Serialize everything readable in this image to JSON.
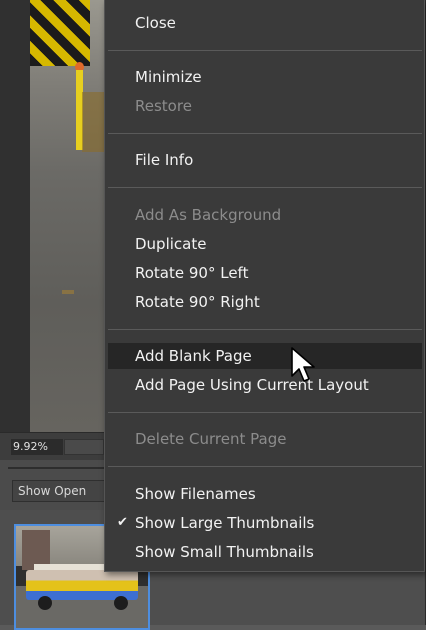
{
  "status": {
    "zoom": "9.92%"
  },
  "bin": {
    "show_open_label": "Show Open"
  },
  "menu": {
    "items": [
      {
        "label": "Close",
        "enabled": true
      },
      {
        "label": "Minimize",
        "enabled": true
      },
      {
        "label": "Restore",
        "enabled": false
      },
      {
        "label": "File Info",
        "enabled": true
      },
      {
        "label": "Add As Background",
        "enabled": false
      },
      {
        "label": "Duplicate",
        "enabled": true
      },
      {
        "label": "Rotate 90° Left",
        "enabled": true
      },
      {
        "label": "Rotate 90° Right",
        "enabled": true
      },
      {
        "label": "Add Blank Page",
        "enabled": true,
        "hovered": true
      },
      {
        "label": "Add Page Using Current Layout",
        "enabled": true
      },
      {
        "label": "Delete Current Page",
        "enabled": false
      },
      {
        "label": "Show Filenames",
        "enabled": true
      },
      {
        "label": "Show Large Thumbnails",
        "enabled": true,
        "checked": true
      },
      {
        "label": "Show Small Thumbnails",
        "enabled": true
      }
    ],
    "check_glyph": "✔"
  },
  "colors": {
    "menu_bg": "#3a3a3a",
    "menu_text": "#f2f2f2",
    "menu_disabled": "#8c8c8c",
    "hover_bg": "#262626",
    "selection_border": "#4d8ee0"
  },
  "icons": {
    "cursor": "arrow-pointer-icon",
    "check": "checkmark-icon"
  }
}
